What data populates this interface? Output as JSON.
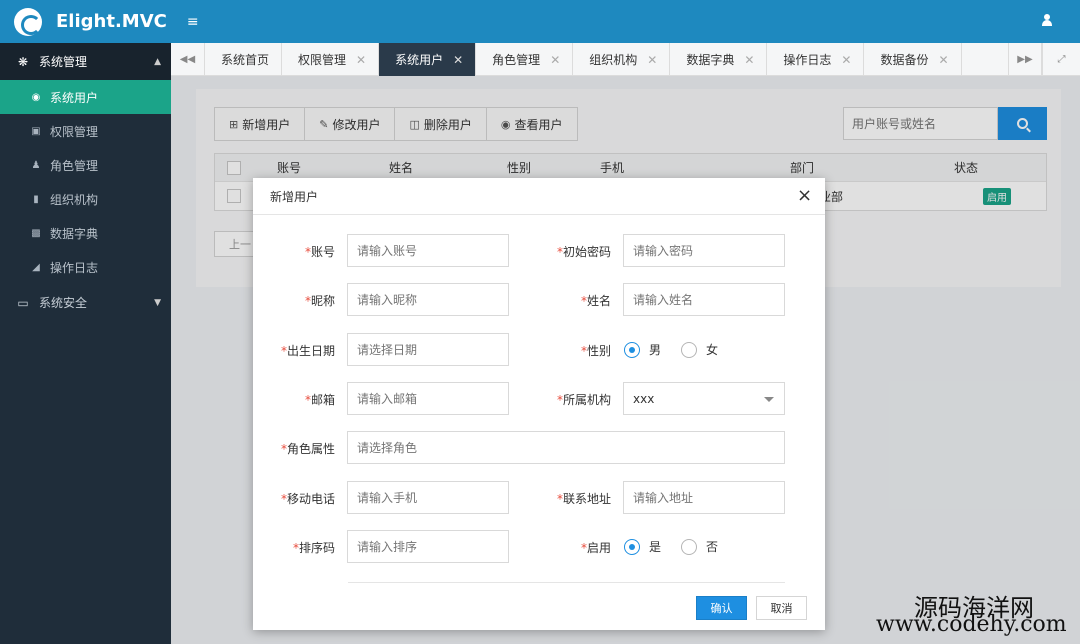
{
  "header": {
    "brand": "Elight.MVC",
    "menu_icon": "list-icon",
    "user_icon": "user-icon"
  },
  "sidebar": {
    "groups": [
      {
        "label": "系统管理",
        "icon": "cubes-icon",
        "items": [
          {
            "label": "系统用户",
            "icon": "user-circle-icon",
            "active": true
          },
          {
            "label": "权限管理",
            "icon": "briefcase-icon"
          },
          {
            "label": "角色管理",
            "icon": "users-icon"
          },
          {
            "label": "组织机构",
            "icon": "book-icon"
          },
          {
            "label": "数据字典",
            "icon": "sitemap-icon"
          },
          {
            "label": "操作日志",
            "icon": "folder-open-icon"
          }
        ]
      },
      {
        "label": "系统安全",
        "icon": "desktop-icon"
      }
    ]
  },
  "tabs": [
    {
      "label": "系统首页"
    },
    {
      "label": "权限管理"
    },
    {
      "label": "系统用户",
      "active": true
    },
    {
      "label": "角色管理"
    },
    {
      "label": "组织机构"
    },
    {
      "label": "数据字典"
    },
    {
      "label": "操作日志"
    },
    {
      "label": "数据备份"
    }
  ],
  "toolbar": {
    "add": "新增用户",
    "edit": "修改用户",
    "delete": "删除用户",
    "view": "查看用户"
  },
  "search": {
    "placeholder": "用户账号或姓名"
  },
  "table": {
    "columns": [
      "账号",
      "姓名",
      "性别",
      "手机",
      "部门",
      "状态"
    ],
    "rows": [
      {
        "department_partial": "业部",
        "status": "启用"
      }
    ]
  },
  "pager": {
    "prev_partial": "上一"
  },
  "modal": {
    "title": "新增用户",
    "fields": {
      "account": {
        "label": "账号",
        "placeholder": "请输入账号"
      },
      "password": {
        "label": "初始密码",
        "placeholder": "请输入密码"
      },
      "nickname": {
        "label": "昵称",
        "placeholder": "请输入昵称"
      },
      "realname": {
        "label": "姓名",
        "placeholder": "请输入姓名"
      },
      "birthday": {
        "label": "出生日期",
        "placeholder": "请选择日期"
      },
      "gender": {
        "label": "性别",
        "options": [
          "男",
          "女"
        ],
        "selected": "男"
      },
      "email": {
        "label": "邮箱",
        "placeholder": "请输入邮箱"
      },
      "org": {
        "label": "所属机构",
        "value": "xxx"
      },
      "role": {
        "label": "角色属性",
        "placeholder": "请选择角色"
      },
      "mobile": {
        "label": "移动电话",
        "placeholder": "请输入手机"
      },
      "address": {
        "label": "联系地址",
        "placeholder": "请输入地址"
      },
      "sort": {
        "label": "排序码",
        "placeholder": "请输入排序"
      },
      "enabled": {
        "label": "启用",
        "options": [
          "是",
          "否"
        ],
        "selected": "是"
      }
    },
    "required_mark": "*",
    "ok": "确认",
    "cancel": "取消"
  },
  "watermark": {
    "line1": "源码海洋网",
    "line2": "www.codehy.com"
  },
  "colors": {
    "header": "#1e89bf",
    "sidebar": "#1f2d3a",
    "active_side": "#1ba489",
    "active_tab": "#2a3a4a",
    "primary": "#1e8fe1"
  }
}
